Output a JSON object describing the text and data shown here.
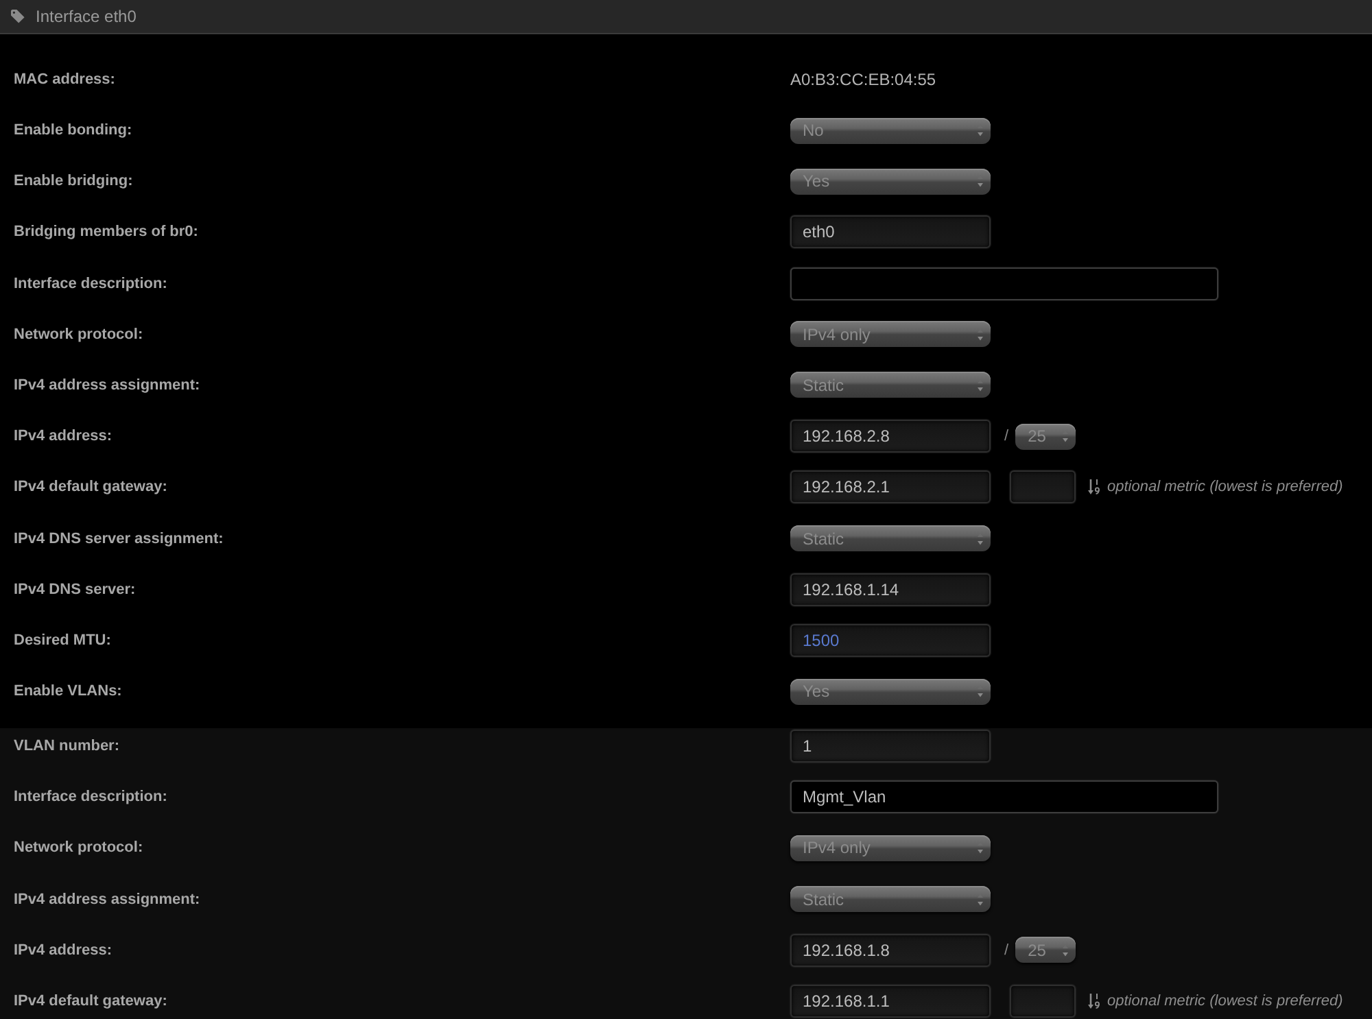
{
  "panel": {
    "title": "Interface eth0"
  },
  "sections": [
    {
      "rows": [
        {
          "kind": "static",
          "label": "MAC address:",
          "value": "A0:B3:CC:EB:04:55"
        },
        {
          "kind": "select",
          "label": "Enable bonding:",
          "value": "No"
        },
        {
          "kind": "select",
          "label": "Enable bridging:",
          "value": "Yes"
        },
        {
          "kind": "input",
          "label": "Bridging members of br0:",
          "value": "eth0"
        },
        {
          "kind": "wide_input",
          "label": "Interface description:"
        },
        {
          "kind": "select",
          "label": "Network protocol:",
          "value": "IPv4 only"
        },
        {
          "kind": "select",
          "label": "IPv4 address assignment:",
          "value": "Static"
        },
        {
          "kind": "address",
          "label": "IPv4 address:",
          "value": "192.168.2.8",
          "separator": "/",
          "prefix": "25"
        },
        {
          "kind": "gateway",
          "label": "IPv4 default gateway:",
          "value": "192.168.2.1",
          "hint": "optional metric (lowest is preferred)"
        },
        {
          "kind": "select",
          "label": "IPv4 DNS server assignment:",
          "value": "Static"
        },
        {
          "kind": "input",
          "label": "IPv4 DNS server:",
          "value": "192.168.1.14"
        },
        {
          "kind": "input",
          "label": "Desired MTU:",
          "placeholder": "1500"
        },
        {
          "kind": "select",
          "label": "Enable VLANs:",
          "value": "Yes"
        }
      ]
    },
    {
      "rows": [
        {
          "kind": "input",
          "label": "VLAN number:",
          "value": "1"
        },
        {
          "kind": "wide_input",
          "label": "Interface description:",
          "value": "Mgmt_Vlan"
        },
        {
          "kind": "select",
          "label": "Network protocol:",
          "value": "IPv4 only"
        },
        {
          "kind": "select",
          "label": "IPv4 address assignment:",
          "value": "Static"
        },
        {
          "kind": "address",
          "label": "IPv4 address:",
          "value": "192.168.1.8",
          "separator": "/",
          "prefix": "25"
        },
        {
          "kind": "gateway",
          "label": "IPv4 default gateway:",
          "value": "192.168.1.1",
          "hint": "optional metric (lowest is preferred)"
        }
      ]
    }
  ]
}
